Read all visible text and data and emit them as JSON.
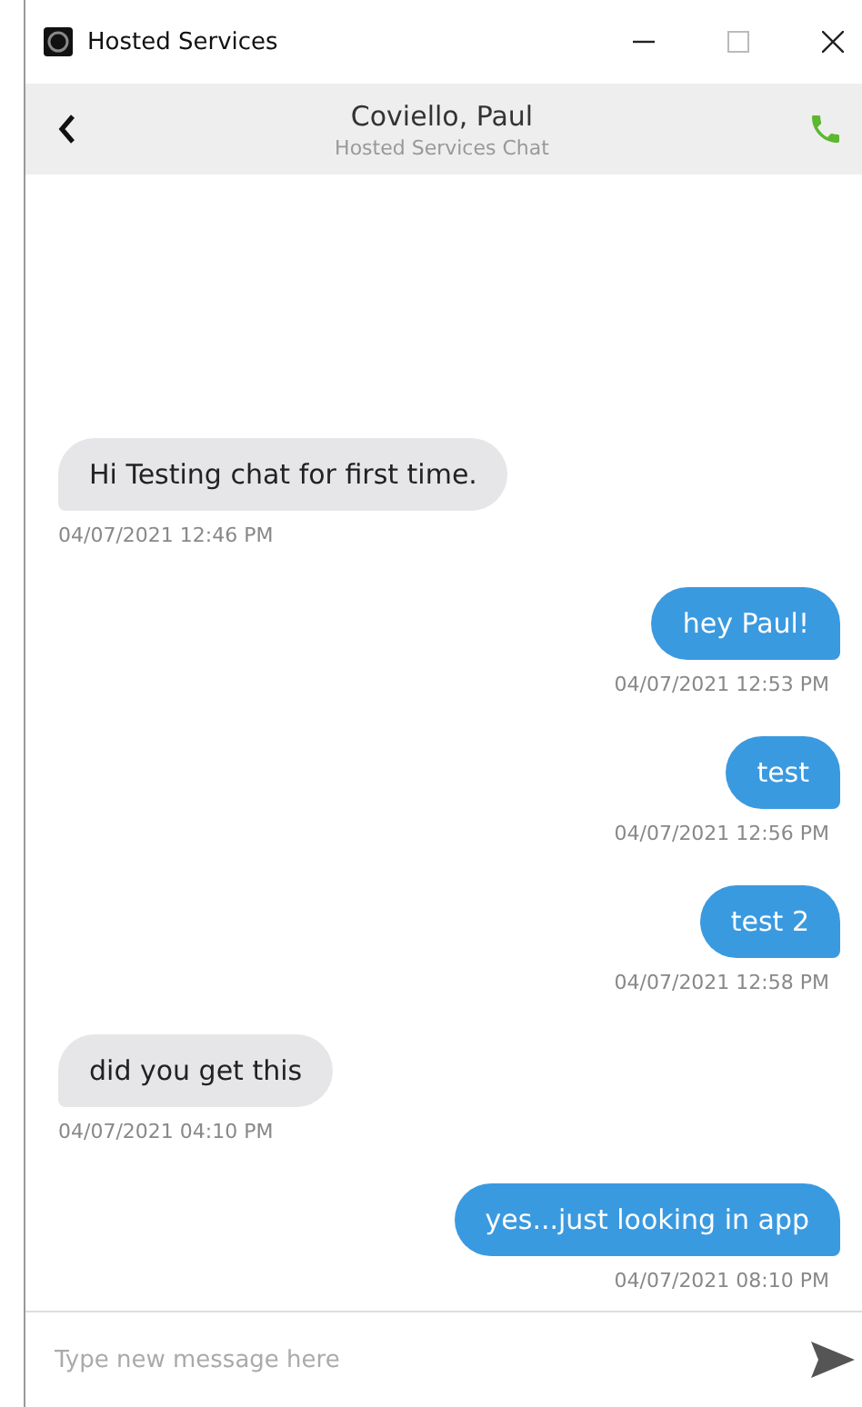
{
  "window": {
    "title": "Hosted Services"
  },
  "header": {
    "name": "Coviello, Paul",
    "subtitle": "Hosted Services Chat"
  },
  "messages": [
    {
      "kind": "received",
      "text": "Hi Testing chat for first time.",
      "time": "04/07/2021 12:46 PM"
    },
    {
      "kind": "sent",
      "text": "hey Paul!",
      "time": "04/07/2021 12:53 PM"
    },
    {
      "kind": "sent",
      "text": "test",
      "time": "04/07/2021 12:56 PM"
    },
    {
      "kind": "sent",
      "text": "test 2",
      "time": "04/07/2021 12:58 PM"
    },
    {
      "kind": "received",
      "text": "did you get this",
      "time": "04/07/2021 04:10 PM"
    },
    {
      "kind": "sent",
      "text": "yes...just looking in app",
      "time": "04/07/2021 08:10 PM"
    }
  ],
  "composer": {
    "placeholder": "Type new message here"
  }
}
